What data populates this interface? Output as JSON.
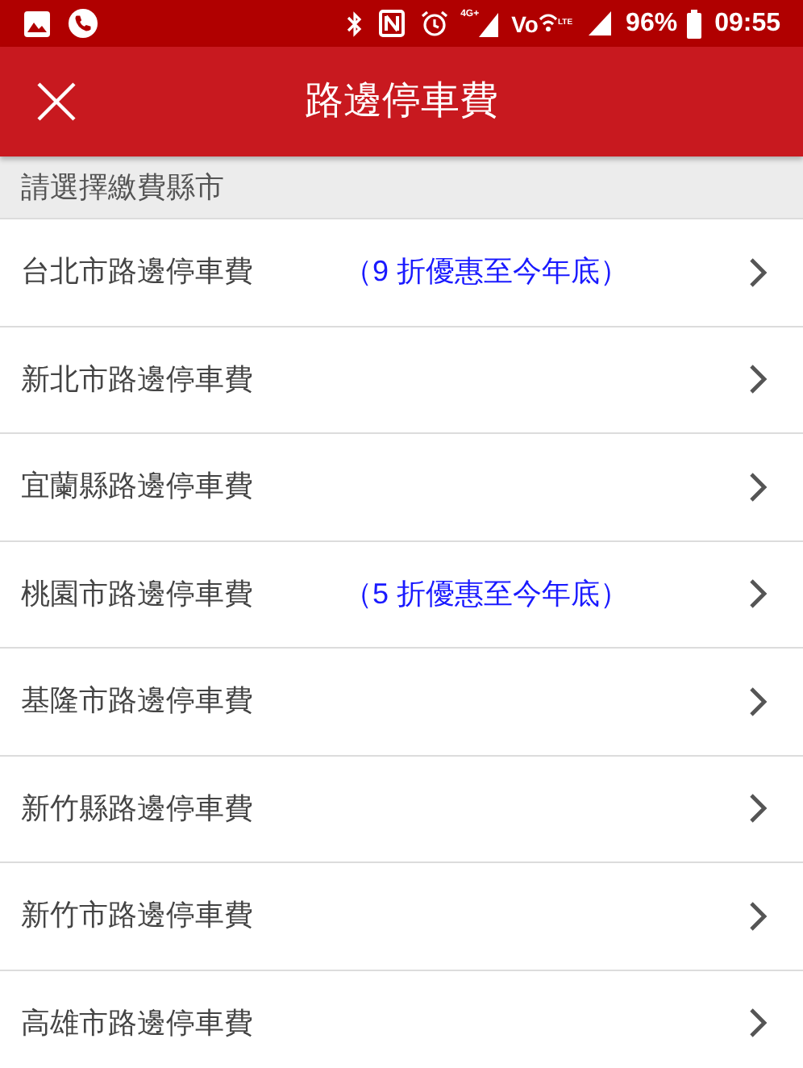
{
  "status_bar": {
    "network_label": "4G+",
    "volte_label": "Vo",
    "lte_label": "LTE",
    "battery": "96%",
    "time": "09:55"
  },
  "header": {
    "title": "路邊停車費"
  },
  "section": {
    "label": "請選擇繳費縣市"
  },
  "items": [
    {
      "label": "台北市路邊停車費",
      "note": "（9 折優惠至今年底）"
    },
    {
      "label": "新北市路邊停車費"
    },
    {
      "label": "宜蘭縣路邊停車費"
    },
    {
      "label": "桃園市路邊停車費",
      "note": "（5 折優惠至今年底）"
    },
    {
      "label": "基隆市路邊停車費"
    },
    {
      "label": "新竹縣路邊停車費"
    },
    {
      "label": "新竹市路邊停車費"
    },
    {
      "label": "高雄市路邊停車費"
    }
  ]
}
